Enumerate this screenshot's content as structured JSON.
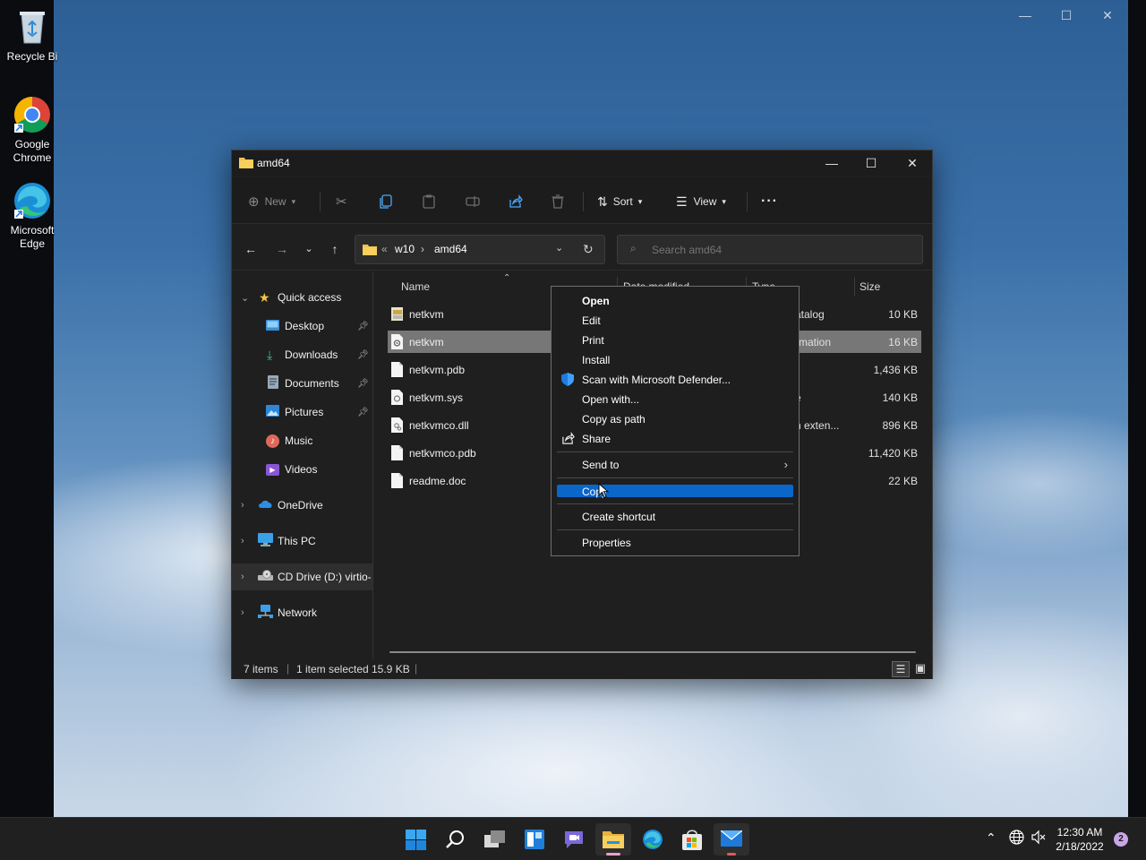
{
  "desktop": {
    "icons": [
      {
        "label": "Recycle Bi",
        "icon": "recycle-bin-icon"
      },
      {
        "label": "Google Chrome",
        "icon": "chrome-icon"
      },
      {
        "label": "Microsoft Edge",
        "icon": "edge-icon"
      }
    ]
  },
  "explorer": {
    "title": "amd64",
    "toolbar": {
      "new_label": "New",
      "sort_label": "Sort",
      "view_label": "View"
    },
    "address": {
      "overflow": "«",
      "crumbs": [
        "w10",
        "amd64"
      ],
      "separator": "›"
    },
    "search": {
      "placeholder": "Search amd64"
    },
    "nav": {
      "quick_access": "Quick access",
      "items": [
        {
          "label": "Desktop",
          "pinned": true
        },
        {
          "label": "Downloads",
          "pinned": true
        },
        {
          "label": "Documents",
          "pinned": true
        },
        {
          "label": "Pictures",
          "pinned": true
        },
        {
          "label": "Music",
          "pinned": false
        },
        {
          "label": "Videos",
          "pinned": false
        }
      ],
      "onedrive": "OneDrive",
      "this_pc": "This PC",
      "cd_drive": "CD Drive (D:) virtio-",
      "network": "Network"
    },
    "columns": {
      "name": "Name",
      "date_modified": "Date modified",
      "type": "Type",
      "size": "Size"
    },
    "files": [
      {
        "name": "netkvm",
        "type": "atalog",
        "size": "10 KB",
        "icon": "catalog-file-icon",
        "selected": false
      },
      {
        "name": "netkvm",
        "type": "rmation",
        "size": "16 KB",
        "icon": "setup-info-file-icon",
        "selected": true
      },
      {
        "name": "netkvm.pdb",
        "type": "",
        "size": "1,436 KB",
        "icon": "file-icon",
        "selected": false
      },
      {
        "name": "netkvm.sys",
        "type": "e",
        "size": "140 KB",
        "icon": "system-file-icon",
        "selected": false
      },
      {
        "name": "netkvmco.dll",
        "type": "n exten...",
        "size": "896 KB",
        "icon": "dll-file-icon",
        "selected": false
      },
      {
        "name": "netkvmco.pdb",
        "type": "",
        "size": "11,420 KB",
        "icon": "file-icon",
        "selected": false
      },
      {
        "name": "readme.doc",
        "type": "",
        "size": "22 KB",
        "icon": "file-icon",
        "selected": false
      }
    ],
    "status": {
      "items": "7 items",
      "selected": "1 item selected",
      "size": "15.9 KB"
    }
  },
  "context_menu": {
    "items": [
      {
        "label": "Open",
        "bold": true
      },
      {
        "label": "Edit"
      },
      {
        "label": "Print"
      },
      {
        "label": "Install"
      },
      {
        "label": "Scan with Microsoft Defender...",
        "icon": "defender-shield-icon"
      },
      {
        "label": "Open with..."
      },
      {
        "label": "Copy as path"
      },
      {
        "label": "Share",
        "icon": "share-icon"
      },
      {
        "label": "Send to",
        "submenu": true
      },
      {
        "label": "Copy",
        "highlighted": true
      },
      {
        "label": "Create shortcut"
      },
      {
        "label": "Properties"
      }
    ],
    "submenu_arrow": "›"
  },
  "taskbar": {
    "apps": [
      "start-icon",
      "search-icon",
      "task-view-icon",
      "widgets-icon",
      "teams-chat-icon",
      "file-explorer-icon",
      "edge-icon",
      "store-icon",
      "mail-icon"
    ],
    "clock_time": "12:30 AM",
    "clock_date": "2/18/2022",
    "notification_count": "2"
  },
  "colors": {
    "accent": "#0a66c8",
    "selection": "#777777",
    "window_bg": "#1f1f1f"
  }
}
